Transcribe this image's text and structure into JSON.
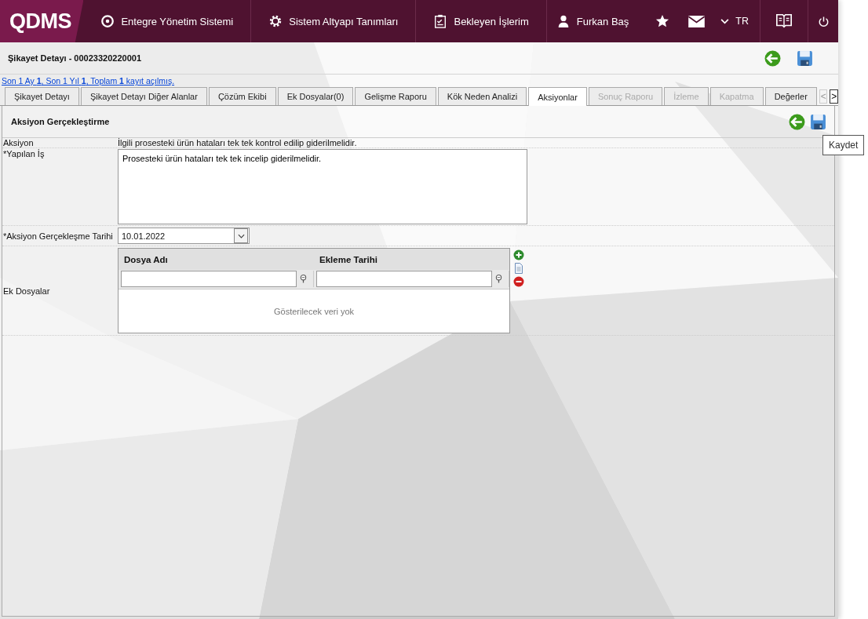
{
  "header": {
    "logo": "QDMS",
    "nav": [
      {
        "label": "Entegre Yönetim Sistemi"
      },
      {
        "label": "Sistem Altyapı Tanımları"
      },
      {
        "label": "Bekleyen İşlerim"
      },
      {
        "label": "Furkan Baş"
      }
    ],
    "language": "TR"
  },
  "page": {
    "title": "Şikayet Detayı - 00023320220001",
    "info_link": "Son 1 Ay **1**, Son 1 Yıl **1**, Toplam **1** kayıt açılmış."
  },
  "tabs": [
    {
      "label": "Şikayet Detayı",
      "selected": false,
      "disabled": false
    },
    {
      "label": "Şikayet Detayı Diğer Alanlar",
      "selected": false,
      "disabled": false
    },
    {
      "label": "Çözüm Ekibi",
      "selected": false,
      "disabled": false
    },
    {
      "label": "Ek Dosyalar(0)",
      "selected": false,
      "disabled": false
    },
    {
      "label": "Gelişme Raporu",
      "selected": false,
      "disabled": false
    },
    {
      "label": "Kök Neden Analizi",
      "selected": false,
      "disabled": false
    },
    {
      "label": "Aksiyonlar",
      "selected": true,
      "disabled": false
    },
    {
      "label": "Sonuç Raporu",
      "selected": false,
      "disabled": true
    },
    {
      "label": "İzleme",
      "selected": false,
      "disabled": true
    },
    {
      "label": "Kapatma",
      "selected": false,
      "disabled": true
    },
    {
      "label": "Değerler",
      "selected": false,
      "disabled": false
    }
  ],
  "tab_scroll": [
    {
      "label": "<",
      "disabled": true
    },
    {
      "label": ">",
      "disabled": false
    }
  ],
  "section": {
    "title": "Aksiyon Gerçekleştirme",
    "tooltip": "Kaydet"
  },
  "form": {
    "action_label": "Aksiyon",
    "action_value": "İlgili prosesteki ürün hataları tek tek kontrol edilip giderilmelidir.",
    "work_label": "*Yapılan İş",
    "work_value": "Prosesteki ürün hataları tek tek incelip giderilmelidir.",
    "date_label": "*Aksiyon Gerçekleşme Tarihi",
    "date_value": "10.01.2022",
    "files_label": "Ek Dosyalar"
  },
  "files_grid": {
    "columns": [
      "Dosya Adı",
      "Ekleme Tarihi"
    ],
    "empty_text": "Gösterilecek veri yok"
  }
}
